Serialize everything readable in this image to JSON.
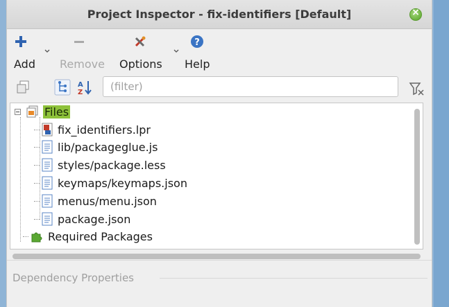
{
  "window": {
    "title": "Project Inspector - fix-identifiers [Default]"
  },
  "toolbar": {
    "add_label": "Add",
    "remove_label": "Remove",
    "options_label": "Options",
    "help_label": "Help"
  },
  "filter": {
    "placeholder": "(filter)",
    "value": ""
  },
  "tree": {
    "root_label": "Files",
    "files": [
      "fix_identifiers.lpr",
      "lib/packageglue.js",
      "styles/package.less",
      "keymaps/keymaps.json",
      "menus/menu.json",
      "package.json"
    ],
    "required_packages_label": "Required Packages"
  },
  "properties": {
    "title": "Dependency Properties"
  },
  "colors": {
    "selection": "#8ec23a",
    "accent_help": "#3a74c4",
    "close": "#6db33f"
  }
}
